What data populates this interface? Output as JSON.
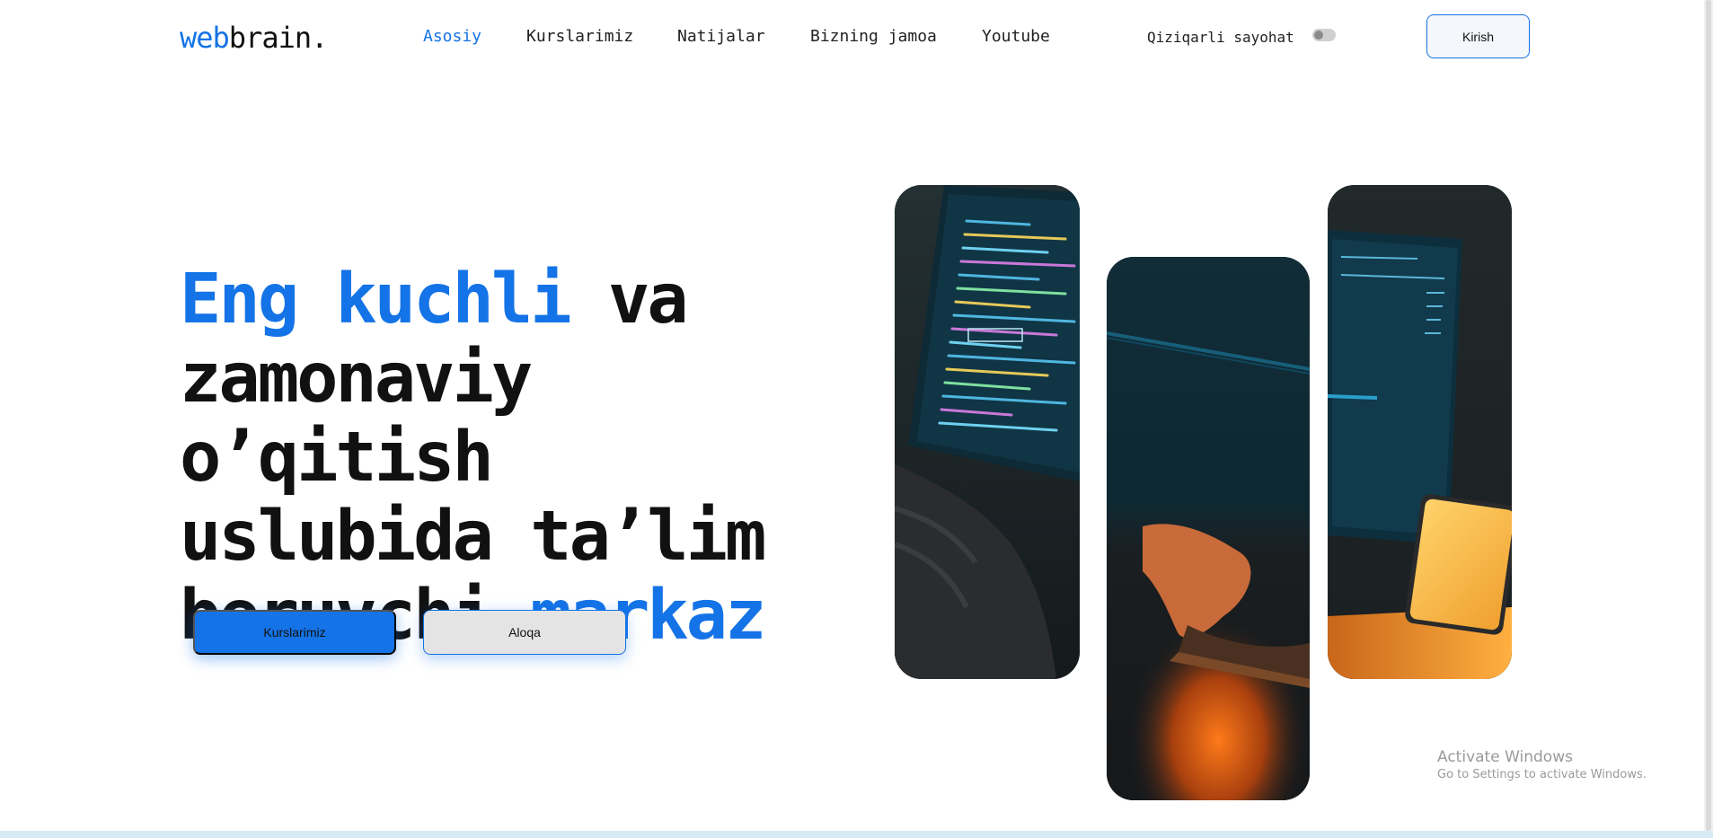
{
  "brand": {
    "logo_part1": "web",
    "logo_part2": "brain."
  },
  "nav": {
    "items": [
      {
        "label": "Asosiy",
        "active": true
      },
      {
        "label": "Kurslarimiz",
        "active": false
      },
      {
        "label": "Natijalar",
        "active": false
      },
      {
        "label": "Bizning jamoa",
        "active": false
      },
      {
        "label": "Youtube",
        "active": false
      }
    ]
  },
  "toggle": {
    "label": "Qiziqarli sayohat",
    "on": false
  },
  "header": {
    "login_label": "Kirish"
  },
  "hero": {
    "title_highlight_1": "Eng kuchli",
    "title_part_1": " va",
    "title_part_2": "zamonaviy o’qitish",
    "title_part_3": "uslubida ta’lim",
    "title_part_4": "beruvchi ",
    "title_highlight_2": "markaz",
    "primary_button": "Kurslarimiz",
    "secondary_button": "Aloqa"
  },
  "images": [
    {
      "icon": "laptop-code-photo"
    },
    {
      "icon": "typing-hands-photo"
    },
    {
      "icon": "laptop-phone-photo"
    }
  ],
  "watermark": {
    "title": "Activate Windows",
    "subtitle": "Go to Settings to activate Windows."
  },
  "colors": {
    "accent": "#1473e6",
    "text": "#111111",
    "secondary_bg": "#e4e4e4"
  }
}
